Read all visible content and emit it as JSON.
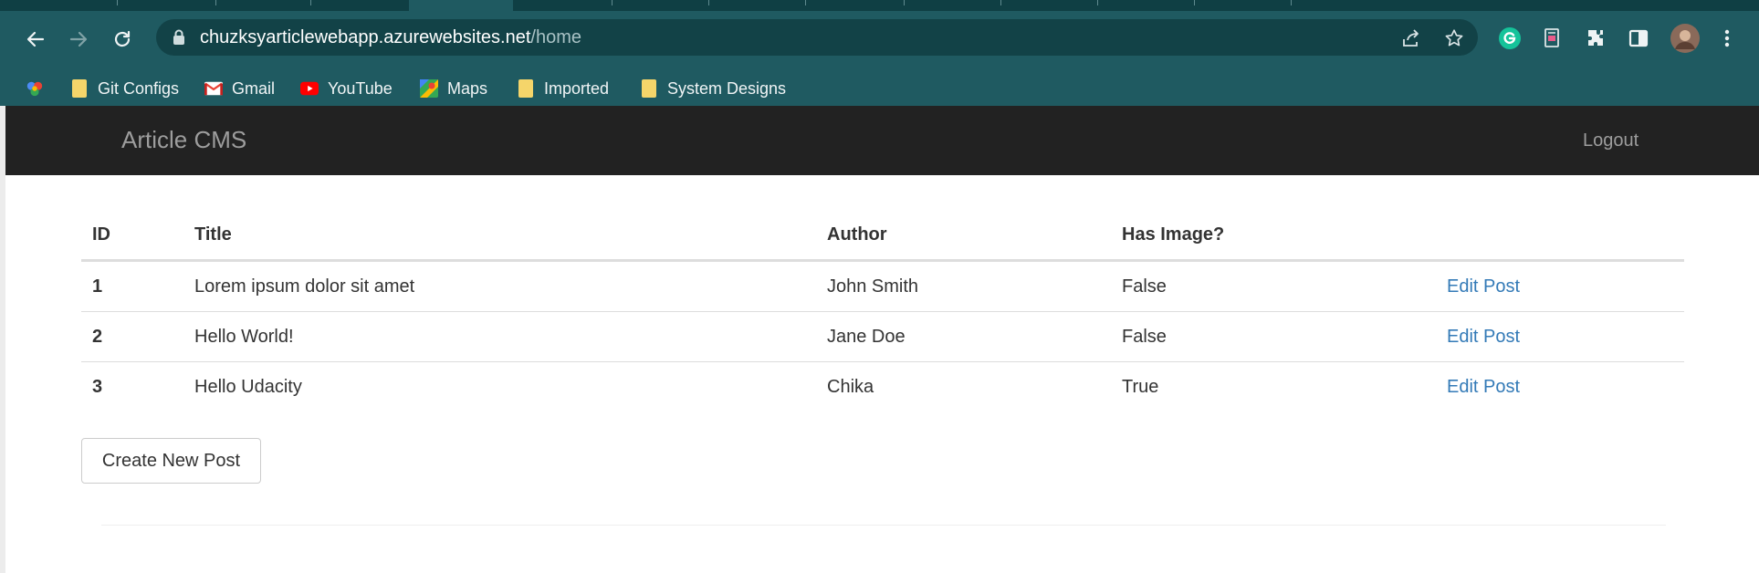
{
  "browser": {
    "url_host": "chuzksyarticlewebapp.azurewebsites.net",
    "url_path": "/home",
    "bookmarks": [
      {
        "label": "",
        "icon": "apps-icon"
      },
      {
        "label": "Git Configs",
        "icon": "folder-icon"
      },
      {
        "label": "Gmail",
        "icon": "gmail-icon"
      },
      {
        "label": "YouTube",
        "icon": "youtube-icon"
      },
      {
        "label": "Maps",
        "icon": "maps-icon"
      },
      {
        "label": "Imported",
        "icon": "folder-icon"
      },
      {
        "label": "System Designs",
        "icon": "folder-icon"
      }
    ],
    "colors": {
      "toolbar": "#1f5a61",
      "omnibox": "#124247"
    }
  },
  "app": {
    "brand": "Article CMS",
    "logout": "Logout",
    "table": {
      "headers": [
        "ID",
        "Title",
        "Author",
        "Has Image?",
        ""
      ],
      "rows": [
        {
          "id": "1",
          "title": "Lorem ipsum dolor sit amet",
          "author": "John Smith",
          "has_image": "False",
          "action": "Edit Post"
        },
        {
          "id": "2",
          "title": "Hello World!",
          "author": "Jane Doe",
          "has_image": "False",
          "action": "Edit Post"
        },
        {
          "id": "3",
          "title": "Hello Udacity",
          "author": "Chika",
          "has_image": "True",
          "action": "Edit Post"
        }
      ]
    },
    "create_button": "Create New Post",
    "colors": {
      "navbar": "#222222",
      "link": "#337ab7"
    }
  }
}
